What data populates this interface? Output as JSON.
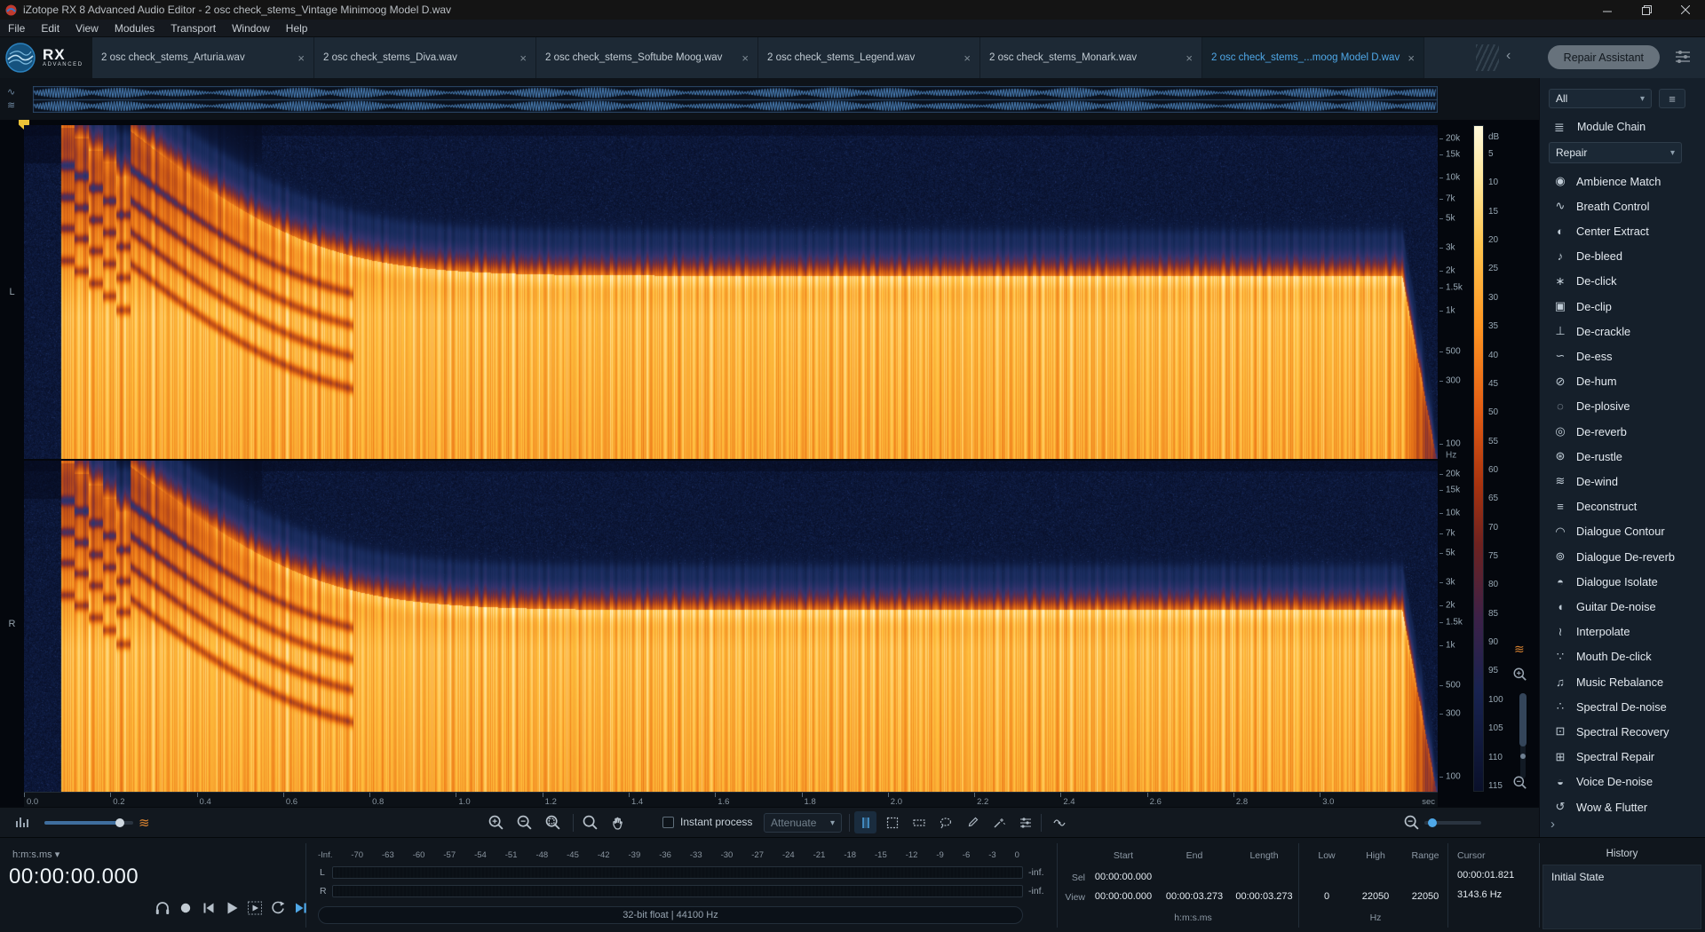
{
  "window": {
    "title": "iZotope RX 8 Advanced Audio Editor - 2 osc check_stems_Vintage Minimoog Model D.wav"
  },
  "menu": {
    "items": [
      "File",
      "Edit",
      "View",
      "Modules",
      "Transport",
      "Window",
      "Help"
    ]
  },
  "brand": {
    "rx": "RX",
    "advanced": "ADVANCED"
  },
  "tabs": {
    "items": [
      {
        "label": "2 osc check_stems_Arturia.wav",
        "active": false
      },
      {
        "label": "2 osc check_stems_Diva.wav",
        "active": false
      },
      {
        "label": "2 osc check_stems_Softube Moog.wav",
        "active": false
      },
      {
        "label": "2 osc check_stems_Legend.wav",
        "active": false
      },
      {
        "label": "2 osc check_stems_Monark.wav",
        "active": false
      },
      {
        "label": "2 osc check_stems_...moog Model D.wav",
        "active": true
      }
    ],
    "close_glyph": "×",
    "nav_back": "‹",
    "repair_assistant": "Repair Assistant"
  },
  "overview": {
    "icons": [
      "∿",
      "≋"
    ]
  },
  "spectrogram": {
    "channels": [
      "L",
      "R"
    ],
    "time_ticks": [
      "0.0",
      "0.2",
      "0.4",
      "0.6",
      "0.8",
      "1.0",
      "1.2",
      "1.4",
      "1.6",
      "1.8",
      "2.0",
      "2.2",
      "2.4",
      "2.6",
      "2.8",
      "3.0"
    ],
    "time_unit": "sec",
    "total_seconds": 3.273,
    "freq_labels": [
      {
        "text": "20k",
        "pct": 3.9
      },
      {
        "text": "15k",
        "pct": 8.8
      },
      {
        "text": "10k",
        "pct": 15.8
      },
      {
        "text": "7k",
        "pct": 22.0
      },
      {
        "text": "5k",
        "pct": 27.8
      },
      {
        "text": "3k",
        "pct": 36.7
      },
      {
        "text": "2k",
        "pct": 43.7
      },
      {
        "text": "1.5k",
        "pct": 48.7
      },
      {
        "text": "1k",
        "pct": 55.7
      },
      {
        "text": "500",
        "pct": 67.7
      },
      {
        "text": "300",
        "pct": 76.5
      },
      {
        "text": "100",
        "pct": 95.5
      }
    ],
    "freq_unit": "Hz",
    "spec_settings_glyph": "≋",
    "db_scale": {
      "title": "dB",
      "labels": [
        "5",
        "10",
        "15",
        "20",
        "25",
        "30",
        "35",
        "40",
        "45",
        "50",
        "55",
        "60",
        "65",
        "70",
        "75",
        "80",
        "85",
        "90",
        "95",
        "100",
        "105",
        "110",
        "115"
      ]
    }
  },
  "toolbar": {
    "instant_process_label": "Instant process",
    "process_mode": "Attenuate",
    "mode_chevron": "▾",
    "waves_glyph": "≋"
  },
  "transport": {
    "time_format": "h:m:s.ms",
    "format_chevron": "▾",
    "time_display": "00:00:00.000"
  },
  "meters": {
    "scale": [
      "-Inf.",
      "-70",
      "-63",
      "-60",
      "-57",
      "-54",
      "-51",
      "-48",
      "-45",
      "-42",
      "-39",
      "-36",
      "-33",
      "-30",
      "-27",
      "-24",
      "-21",
      "-18",
      "-15",
      "-12",
      "-9",
      "-6",
      "-3",
      "0"
    ],
    "left_label": "L",
    "right_label": "R",
    "left_value": "-inf.",
    "right_value": "-inf.",
    "format_info": "32-bit float | 44100 Hz"
  },
  "selection": {
    "start_header": "Start",
    "end_header": "End",
    "length_header": "Length",
    "sel_label": "Sel",
    "view_label": "View",
    "sel_start": "00:00:00.000",
    "view_start": "00:00:00.000",
    "view_end": "00:00:03.273",
    "view_length": "00:00:03.273",
    "time_format": "h:m:s.ms"
  },
  "freq_range": {
    "low_header": "Low",
    "high_header": "High",
    "range_header": "Range",
    "low": "0",
    "high": "22050",
    "range": "22050",
    "unit": "Hz"
  },
  "cursor": {
    "label": "Cursor",
    "time": "00:00:01.821",
    "frequency": "3143.6 Hz"
  },
  "history": {
    "title": "History",
    "items": [
      "Initial State"
    ]
  },
  "sidebar": {
    "filter_value": "All",
    "filter_chevron": "▾",
    "hamburger_glyph": "≡",
    "module_chain_label": "Module Chain",
    "module_chain_glyph": "≣",
    "category_value": "Repair",
    "category_chevron": "▾",
    "expand_glyph": "›",
    "modules": [
      {
        "name": "Ambience Match",
        "glyph": "◉"
      },
      {
        "name": "Breath Control",
        "glyph": "∿"
      },
      {
        "name": "Center Extract",
        "glyph": "◐"
      },
      {
        "name": "De-bleed",
        "glyph": "♪"
      },
      {
        "name": "De-click",
        "glyph": "∗"
      },
      {
        "name": "De-clip",
        "glyph": "▣"
      },
      {
        "name": "De-crackle",
        "glyph": "⊥"
      },
      {
        "name": "De-ess",
        "glyph": "∽"
      },
      {
        "name": "De-hum",
        "glyph": "⊘"
      },
      {
        "name": "De-plosive",
        "glyph": "◌"
      },
      {
        "name": "De-reverb",
        "glyph": "◎"
      },
      {
        "name": "De-rustle",
        "glyph": "⊛"
      },
      {
        "name": "De-wind",
        "glyph": "≋"
      },
      {
        "name": "Deconstruct",
        "glyph": "≡"
      },
      {
        "name": "Dialogue Contour",
        "glyph": "◠"
      },
      {
        "name": "Dialogue De-reverb",
        "glyph": "⊚"
      },
      {
        "name": "Dialogue Isolate",
        "glyph": "◓"
      },
      {
        "name": "Guitar De-noise",
        "glyph": "◖"
      },
      {
        "name": "Interpolate",
        "glyph": "≀"
      },
      {
        "name": "Mouth De-click",
        "glyph": "∵"
      },
      {
        "name": "Music Rebalance",
        "glyph": "♫"
      },
      {
        "name": "Spectral De-noise",
        "glyph": "∴"
      },
      {
        "name": "Spectral Recovery",
        "glyph": "⊡"
      },
      {
        "name": "Spectral Repair",
        "glyph": "⊞"
      },
      {
        "name": "Voice De-noise",
        "glyph": "◒"
      },
      {
        "name": "Wow & Flutter",
        "glyph": "↺"
      }
    ]
  }
}
